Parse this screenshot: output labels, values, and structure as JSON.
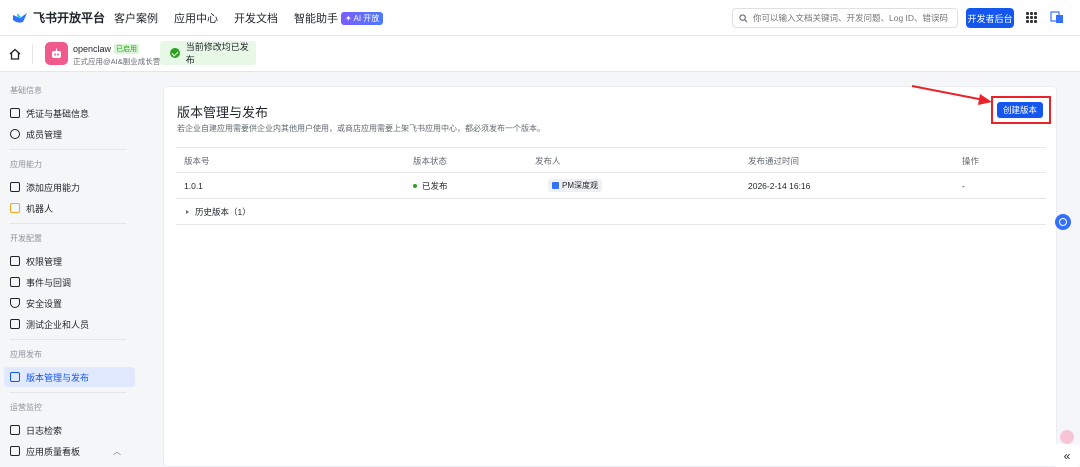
{
  "topnav": {
    "brand": "飞书开放平台",
    "links": [
      "客户案例",
      "应用中心",
      "开发文档",
      "智能助手"
    ],
    "ai_badge": "✦ AI 开放",
    "search_placeholder": "你可以输入文档关键词、开发问题、Log ID、错误码",
    "dev_console": "开发者后台"
  },
  "appbar": {
    "app_name": "openclaw",
    "app_tag": "已启用",
    "app_sub": "正式应用@AI&副业成长营",
    "status": "当前修改均已发布"
  },
  "sidebar": {
    "groups": [
      "基础信息",
      "应用能力",
      "开发配置",
      "应用发布",
      "运营监控"
    ],
    "items": [
      "凭证与基础信息",
      "成员管理",
      "添加应用能力",
      "机器人",
      "权限管理",
      "事件与回调",
      "安全设置",
      "测试企业和人员",
      "版本管理与发布",
      "日志检索",
      "应用质量看板"
    ]
  },
  "main": {
    "title": "版本管理与发布",
    "desc": "若企业自建应用需要供企业内其他用户使用，或商店应用需要上架飞书应用中心，都必须发布一个版本。",
    "create_button": "创建版本",
    "columns": [
      "版本号",
      "版本状态",
      "发布人",
      "发布通过时间",
      "操作"
    ],
    "rows": [
      {
        "version": "1.0.1",
        "status": "已发布",
        "publisher": "PM深度观",
        "time": "2026-2-14 16:16",
        "action": "-"
      }
    ],
    "history": "历史版本（1）"
  },
  "colors": {
    "primary": "#1456f0",
    "success": "#2ea121",
    "annotation": "#e8232a"
  }
}
